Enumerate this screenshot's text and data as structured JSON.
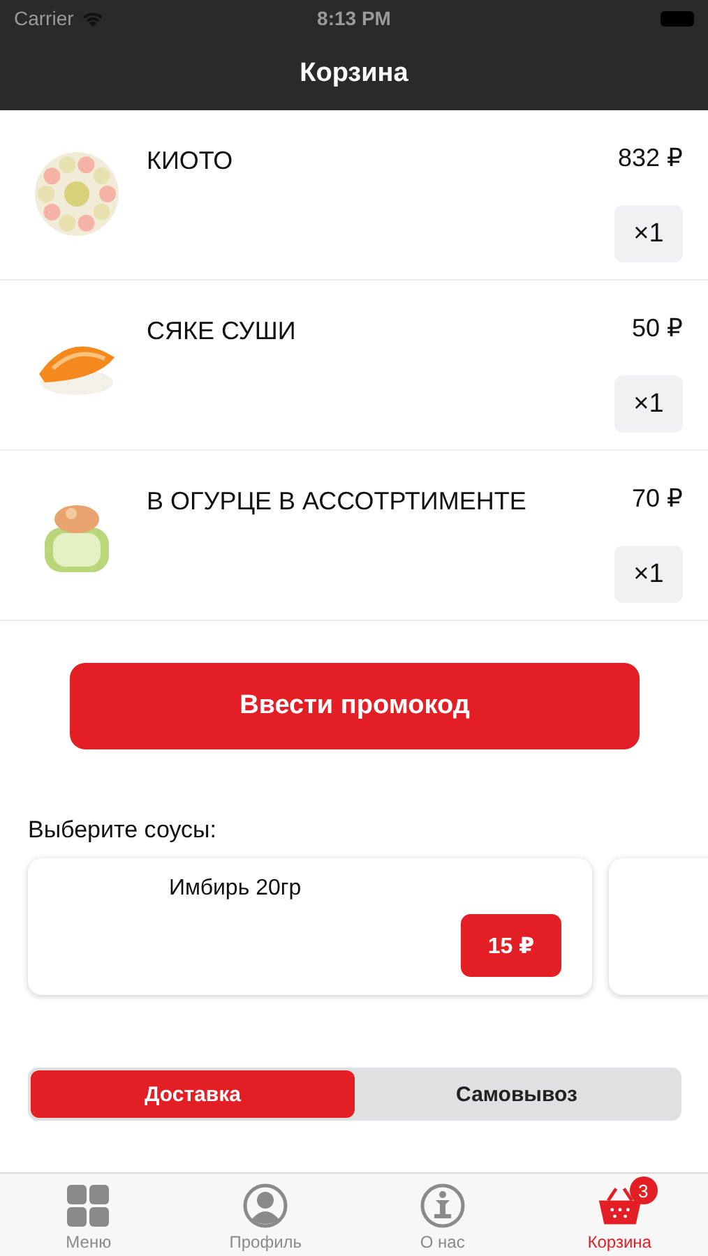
{
  "status_bar": {
    "carrier": "Carrier",
    "time": "8:13 PM"
  },
  "nav": {
    "title": "Корзина"
  },
  "cart_items": [
    {
      "name": "КИОТО",
      "price": "832 ₽",
      "quantity": "×1"
    },
    {
      "name": "СЯКЕ СУШИ",
      "price": "50 ₽",
      "quantity": "×1"
    },
    {
      "name": "В ОГУРЦЕ В АССОТРТИМЕНТЕ",
      "price": "70 ₽",
      "quantity": "×1"
    }
  ],
  "promo_button": "Ввести промокод",
  "sauces": {
    "title": "Выберите соусы:",
    "items": [
      {
        "name": "Имбирь 20гр",
        "price": "15 ₽"
      }
    ]
  },
  "delivery_options": [
    {
      "label": "Доставка",
      "selected": true
    },
    {
      "label": "Самовывоз",
      "selected": false
    }
  ],
  "tab_bar": [
    {
      "label": "Меню",
      "kind": "grid",
      "selected": false
    },
    {
      "label": "Профиль",
      "kind": "profile",
      "selected": false
    },
    {
      "label": "О нас",
      "kind": "info",
      "selected": false
    },
    {
      "label": "Корзина",
      "kind": "basket",
      "selected": true,
      "badge": "3"
    }
  ]
}
